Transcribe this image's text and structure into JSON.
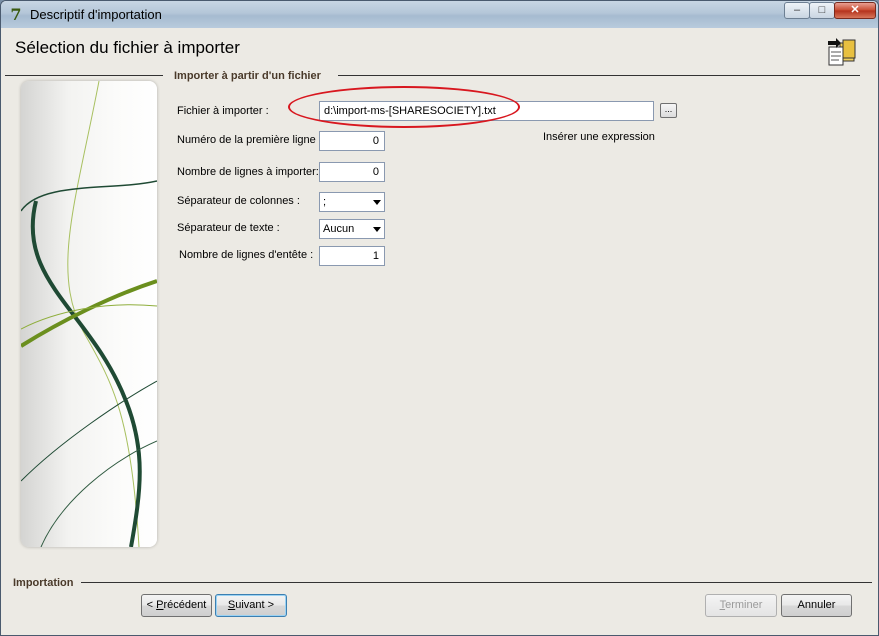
{
  "window": {
    "title": "Descriptif d'importation"
  },
  "header": {
    "title": "Sélection du fichier à importer"
  },
  "group": {
    "title": "Importer à partir d'un fichier"
  },
  "form": {
    "file_label": "Fichier à importer :",
    "file_value": "d:\\import-ms-[SHARESOCIETY].txt",
    "browse_label": "...",
    "insert_expression": "Insérer une expression",
    "first_line_label": "Numéro de la première ligne :",
    "first_line_value": "0",
    "line_count_label": "Nombre de lignes à importer:",
    "line_count_value": "0",
    "col_sep_label": "Séparateur de colonnes :",
    "col_sep_value": ";",
    "text_sep_label": "Séparateur de texte :",
    "text_sep_value": "Aucun",
    "header_lines_label": "Nombre de lignes d'entête :",
    "header_lines_value": "1"
  },
  "footer": {
    "title": "Importation",
    "prev_prefix": "< ",
    "prev_hot": "P",
    "prev_rest": "récédent",
    "next_hot": "S",
    "next_rest": "uivant >",
    "finish_hot": "T",
    "finish_rest": "erminer",
    "cancel_label": "Annuler"
  },
  "colors": {
    "highlight_ellipse": "#d8171f",
    "accent_green": "#6b8f1e",
    "dark_green": "#1f4a34"
  }
}
